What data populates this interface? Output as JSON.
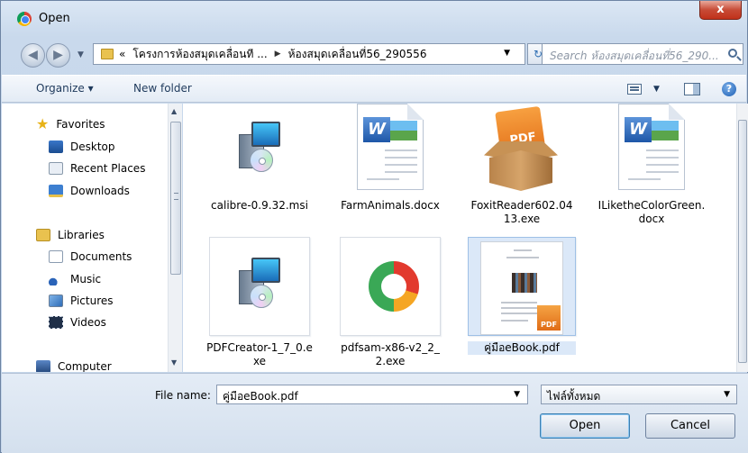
{
  "window": {
    "title": "Open",
    "close_glyph": "x"
  },
  "address": {
    "crumb_prefix": "«",
    "crumb_1": "โครงการห้องสมุดเคลื่อนที ...",
    "crumb_2": "ห้องสมุดเคลื่อนที่56_290556",
    "search_placeholder": "Search ห้องสมุดเคลื่อนที่56_290..."
  },
  "toolbar": {
    "organize_label": "Organize ▾",
    "new_folder_label": "New folder",
    "help_glyph": "?"
  },
  "nav": {
    "favorites": "Favorites",
    "desktop": "Desktop",
    "recent_places": "Recent Places",
    "downloads": "Downloads",
    "libraries": "Libraries",
    "documents": "Documents",
    "music": "Music",
    "pictures": "Pictures",
    "videos": "Videos",
    "computer": "Computer"
  },
  "files": [
    {
      "name": "calibre-0.9.32.msi",
      "icon": "installer-icon"
    },
    {
      "name": "FarmAnimals.docx",
      "icon": "word-document-icon"
    },
    {
      "name": "FoxitReader602.0413.exe",
      "icon": "foxit-icon"
    },
    {
      "name": "ILiketheColorGreen.docx",
      "icon": "word-document-icon"
    },
    {
      "name": "PDFCreator-1_7_0.exe",
      "icon": "installer-icon"
    },
    {
      "name": "pdfsam-x86-v2_2_2.exe",
      "icon": "pdfsam-icon"
    },
    {
      "name": "คู่มือeBook.pdf",
      "icon": "pdf-thumbnail-icon",
      "selected": true
    }
  ],
  "footer": {
    "file_name_label": "File name:",
    "file_name_value": "คู่มือeBook.pdf",
    "file_type_value": "ไฟล์ทั้งหมด",
    "open_label": "Open",
    "cancel_label": "Cancel"
  },
  "colors": {
    "selection": "#dbe8f8",
    "close_button": "#c74b36",
    "frame": "#c4d5ea"
  }
}
